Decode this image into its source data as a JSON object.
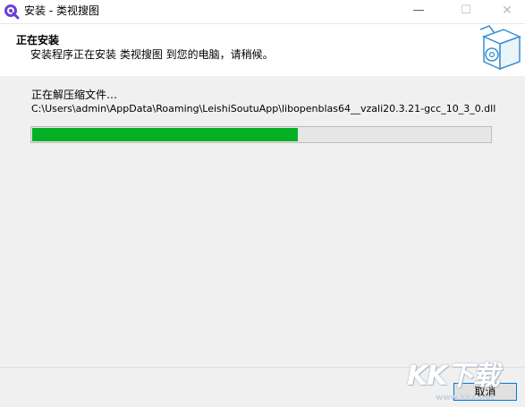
{
  "window": {
    "title": "安装 - 类视搜图",
    "minimize_glyph": "—",
    "maximize_glyph": "☐",
    "close_glyph": "✕"
  },
  "header": {
    "title": "正在安装",
    "subtitle": "安装程序正在安装 类视搜图 到您的电脑，请稍候。",
    "icon": "software-box-icon"
  },
  "content": {
    "status": "正在解压缩文件…",
    "file_path": "C:\\Users\\admin\\AppData\\Roaming\\LeishiSoutuApp\\libopenblas64__vzali20.3.21-gcc_10_3_0.dll",
    "progress_fraction": 0.58
  },
  "footer": {
    "cancel_label": "取消"
  },
  "watermark": {
    "text": "KK下载",
    "sub": "www.kkx.net"
  },
  "colors": {
    "progress_fill": "#06b025",
    "accent": "#0078d7"
  }
}
